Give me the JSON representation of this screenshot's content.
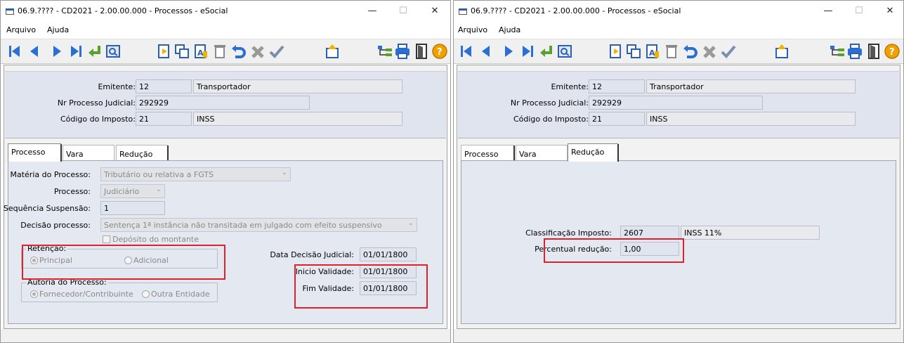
{
  "window_title": "06.9.???? - CD2021 - 2.00.00.000 - Processos - eSocial",
  "controls": {
    "minimize": "—",
    "maximize": "☐",
    "close": "✕"
  },
  "menu": {
    "arquivo": "Arquivo",
    "ajuda": "Ajuda"
  },
  "toolbar_icons": [
    "first-record-icon",
    "previous-record-icon",
    "next-record-icon",
    "last-record-icon",
    "go-to-icon",
    "search-icon",
    "new-record-icon",
    "copy-record-icon",
    "edit-record-icon",
    "delete-record-icon",
    "undo-icon",
    "cancel-icon",
    "confirm-icon",
    "upload-icon",
    "tree-icon",
    "print-icon",
    "exit-icon",
    "help-icon"
  ],
  "header": {
    "emitente_label": "Emitente:",
    "emitente_code": "12",
    "emitente_name": "Transportador",
    "processo_label": "Nr Processo Judicial:",
    "processo_value": "292929",
    "imposto_label": "Código do Imposto:",
    "imposto_code": "21",
    "imposto_name": "INSS"
  },
  "tabs": {
    "processo": "Processo",
    "vara": "Vara",
    "reducao": "Redução"
  },
  "processo_tab": {
    "materia_label": "Matéria do Processo:",
    "materia_value": "Tributário ou relativa a FGTS",
    "processo_label": "Processo:",
    "processo_value": "Judiciário",
    "sequencia_label": "Sequência Suspensão:",
    "sequencia_value": "1",
    "decisao_label": "Decisão processo:",
    "decisao_value": "Sentença 1ª instância não transitada em julgado com efeito suspensivo",
    "deposito_label": "Depósito do montante",
    "retencao_legend": "Retenção:",
    "retencao_principal": "Principal",
    "retencao_adicional": "Adicional",
    "autoria_legend": "Autoria do Processo:",
    "autoria_fornecedor": "Fornecedor/Contribuinte",
    "autoria_outra": "Outra Entidade",
    "data_decisao_label": "Data Decisão Judicial:",
    "data_decisao_value": "01/01/1800",
    "inicio_label": "Inicio Validade:",
    "inicio_value": "01/01/1800",
    "fim_label": "Fim Validade:",
    "fim_value": "01/01/1800"
  },
  "reducao_tab": {
    "classificacao_label": "Classificação Imposto:",
    "classificacao_code": "2607",
    "classificacao_desc": "INSS 11%",
    "percentual_label": "Percentual redução:",
    "percentual_value": "1,00"
  },
  "colors": {
    "highlight": "#e0202a",
    "panel": "#dfe4ee"
  }
}
